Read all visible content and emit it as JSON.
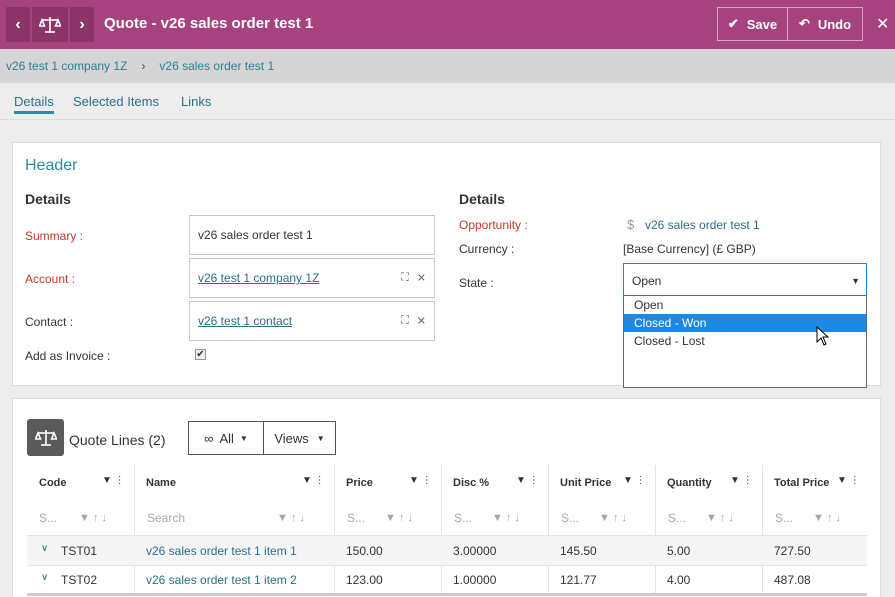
{
  "app": {
    "title": "Quote - v26 sales order test 1",
    "save_label": "Save",
    "undo_label": "Undo",
    "back": "‹",
    "forward": "›",
    "close": "✕"
  },
  "breadcrumb": [
    "v26 test 1 company 1Z",
    "v26 sales order test 1"
  ],
  "tabs": [
    "Details",
    "Selected Items",
    "Links"
  ],
  "header": {
    "title": "Header",
    "left": {
      "section": "Details",
      "summary_label": "Summary :",
      "summary_value": "v26 sales order test 1",
      "account_label": "Account :",
      "account_value": "v26 test 1 company 1Z",
      "contact_label": "Contact :",
      "contact_value": "v26 test 1 contact",
      "invoice_label": "Add as Invoice :",
      "invoice_checked": true
    },
    "right": {
      "section": "Details",
      "opportunity_label": "Opportunity :",
      "opportunity_value": "v26 sales order test 1",
      "currency_label": "Currency :",
      "currency_value": "[Base Currency] (£ GBP)",
      "state_label": "State :",
      "state_value": "Open",
      "state_options": [
        "Open",
        "Closed - Won",
        "Closed - Lost"
      ],
      "state_highlighted": "Closed - Won"
    }
  },
  "quote_lines": {
    "title": "Quote Lines",
    "count": "(2)",
    "filter_label": "All",
    "views_label": "Views",
    "columns": [
      "Code",
      "Name",
      "Price",
      "Disc %",
      "Unit Price",
      "Quantity",
      "Total Price"
    ],
    "search_short": "S...",
    "search_placeholder": "Search",
    "rows": [
      {
        "code": "TST01",
        "name": "v26 sales order test 1 item 1",
        "price": "150.00",
        "disc": "3.00000",
        "unit": "145.50",
        "qty": "5.00",
        "total": "727.50"
      },
      {
        "code": "TST02",
        "name": "v26 sales order test 1 item 2",
        "price": "123.00",
        "disc": "1.00000",
        "unit": "121.77",
        "qty": "4.00",
        "total": "487.08"
      }
    ]
  },
  "colors": {
    "topbar": "#a6427e",
    "accent": "#2a8f9f",
    "link": "#2a6f8a",
    "required": "#c0392b",
    "highlight": "#1e88e5"
  }
}
